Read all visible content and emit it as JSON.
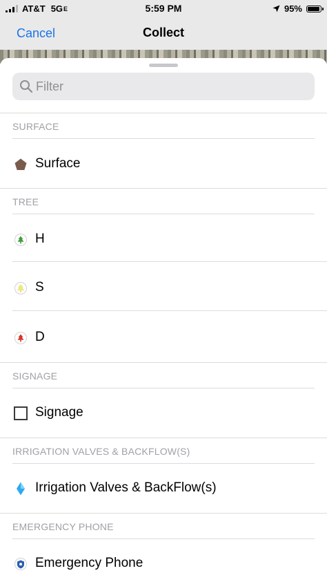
{
  "status_bar": {
    "carrier": "AT&T",
    "network": "5G",
    "network_suffix": "E",
    "time": "5:59 PM",
    "battery": "95%",
    "battery_level": 0.95
  },
  "nav": {
    "cancel": "Cancel",
    "title": "Collect"
  },
  "filter": {
    "placeholder": "Filter",
    "value": ""
  },
  "sections": {
    "surface": {
      "header": "SURFACE",
      "items": [
        {
          "label": "Surface",
          "icon": "brown-pentagon-icon",
          "color": "#7a5b4c"
        }
      ]
    },
    "tree": {
      "header": "TREE",
      "items": [
        {
          "label": "H",
          "icon": "green-tree-icon",
          "color": "#3f9f3b"
        },
        {
          "label": "S",
          "icon": "yellow-tree-icon",
          "color": "#f3e97a"
        },
        {
          "label": "D",
          "icon": "red-tree-icon",
          "color": "#d8342c"
        }
      ]
    },
    "signage": {
      "header": "SIGNAGE",
      "items": [
        {
          "label": "Signage",
          "icon": "square-outline-icon",
          "color": "#3a3a3a"
        }
      ]
    },
    "irrigation": {
      "header": "IRRIGATION VALVES & BACKFLOW(S)",
      "items": [
        {
          "label": "Irrigation Valves & BackFlow(s)",
          "icon": "blue-diamond-icon",
          "color": "#2fa9f0"
        }
      ]
    },
    "emergency": {
      "header": "EMERGENCY PHONE",
      "items": [
        {
          "label": "Emergency Phone",
          "icon": "blue-shield-icon",
          "color": "#2a5db0"
        }
      ]
    }
  }
}
